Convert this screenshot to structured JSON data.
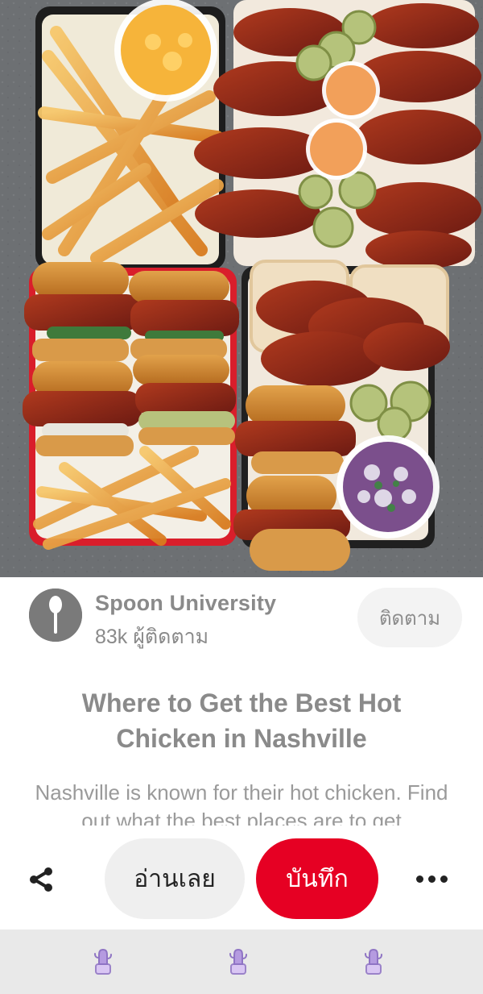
{
  "pin": {
    "author_name": "Spoon University",
    "followers": "83k ผู้ติดตาม",
    "follow_label": "ติดตาม",
    "title": "Where to Get the Best Hot Chicken in Nashville",
    "description": "Nashville is known for their hot chicken. Find out what the best places are to get"
  },
  "actions": {
    "read_label": "อ่านเลย",
    "save_label": "บันทึก"
  },
  "icons": {
    "avatar": "spoon-icon",
    "share": "share-icon",
    "more": "more-icon",
    "bottom": [
      "cactus-icon",
      "cactus-icon",
      "cactus-icon"
    ]
  },
  "colors": {
    "save": "#e60023"
  }
}
